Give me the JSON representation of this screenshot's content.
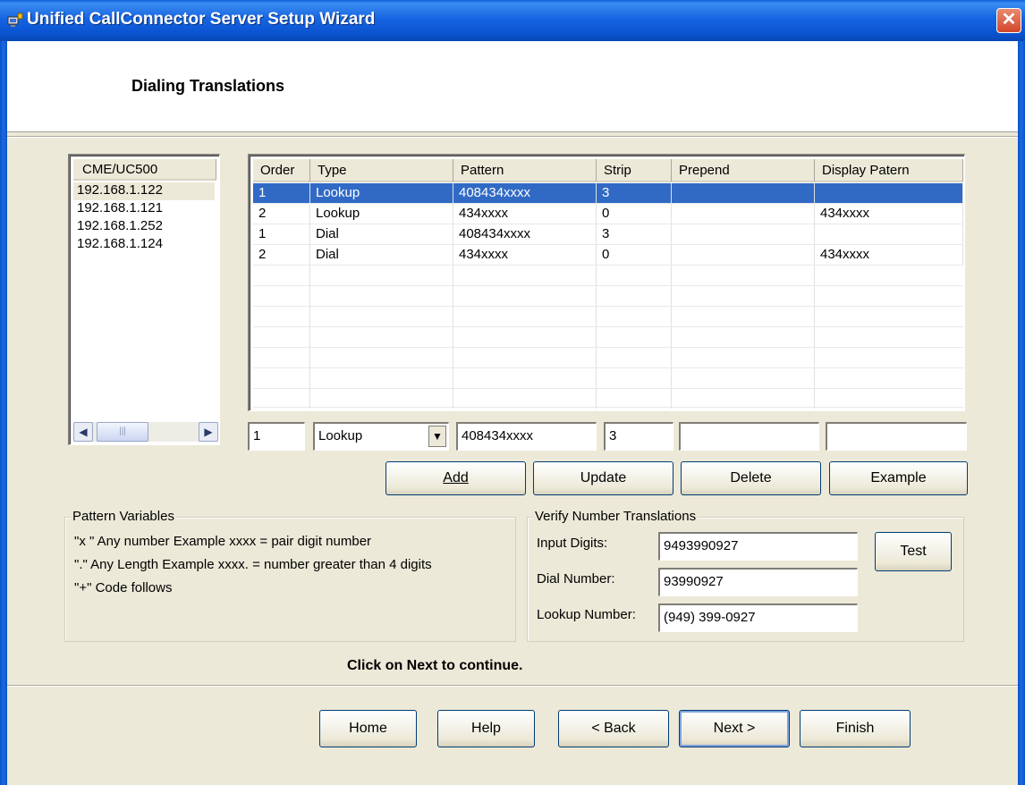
{
  "window": {
    "title": "Unified CallConnector Server Setup Wizard",
    "close_glyph": "✕"
  },
  "header": {
    "title": "Dialing Translations"
  },
  "server_list": {
    "header": "CME/UC500",
    "items": [
      "192.168.1.122",
      "192.168.1.121",
      "192.168.1.252",
      "192.168.1.124"
    ],
    "selected_index": 0
  },
  "grid": {
    "columns": [
      "Order",
      "Type",
      "Pattern",
      "Strip",
      "Prepend",
      "Display Patern"
    ],
    "rows": [
      [
        "1",
        "Lookup",
        "408434xxxx",
        "3",
        "",
        ""
      ],
      [
        "2",
        "Lookup",
        "434xxxx",
        "0",
        "",
        "434xxxx"
      ],
      [
        "1",
        "Dial",
        "408434xxxx",
        "3",
        "",
        ""
      ],
      [
        "2",
        "Dial",
        "434xxxx",
        "0",
        "",
        "434xxxx"
      ]
    ],
    "selected_row": 0
  },
  "edit_row": {
    "order": "1",
    "type": "Lookup",
    "pattern": "408434xxxx",
    "strip": "3",
    "prepend": "",
    "display_pattern": ""
  },
  "actions": {
    "add": "Add",
    "update": "Update",
    "delete": "Delete",
    "example": "Example"
  },
  "pattern_variables": {
    "title": "Pattern Variables",
    "lines": [
      "\"x \" Any number  Example xxxx = pair digit number",
      "\".\" Any Length   Example xxxx. = number greater than 4 digits",
      "\"+\" Code follows"
    ]
  },
  "verify": {
    "title": "Verify Number Translations",
    "input_digits_label": "Input Digits:",
    "input_digits_value": "9493990927",
    "dial_number_label": "Dial Number:",
    "dial_number_value": "93990927",
    "lookup_number_label": "Lookup Number:",
    "lookup_number_value": "(949) 399-0927",
    "test_button": "Test"
  },
  "footer": {
    "instruction": "Click on Next to continue.",
    "home": "Home",
    "help": "Help",
    "back": "< Back",
    "next": "Next >",
    "finish": "Finish"
  },
  "icons": {
    "app": "computer-plug-icon",
    "close": "close-icon",
    "scroll_left": "◀",
    "scroll_right": "▶",
    "combo_arrow": "▼"
  },
  "colors": {
    "titlebar": "#0b54d1",
    "selection": "#316ac5",
    "dialog_bg": "#ece9d8"
  }
}
